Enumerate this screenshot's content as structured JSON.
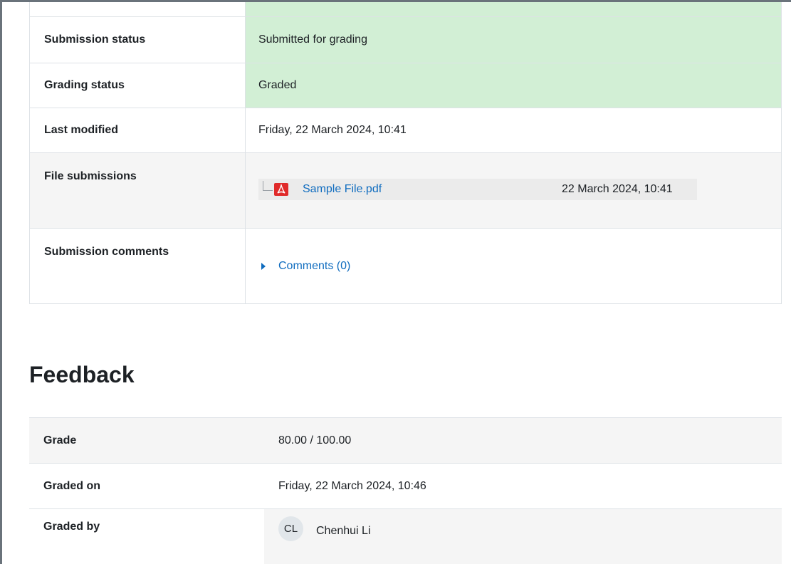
{
  "submission": {
    "rows": {
      "submission_status": {
        "label": "Submission status",
        "value": "Submitted for grading"
      },
      "grading_status": {
        "label": "Grading status",
        "value": "Graded"
      },
      "last_modified": {
        "label": "Last modified",
        "value": "Friday, 22 March 2024, 10:41"
      },
      "file_submissions": {
        "label": "File submissions",
        "file_name": "Sample File.pdf",
        "file_date": "22 March 2024, 10:41",
        "icon": "pdf-file-icon"
      },
      "submission_comments": {
        "label": "Submission comments",
        "link": "Comments (0)"
      }
    },
    "colors": {
      "success_bg": "#d2efd5",
      "link": "#0f6cbf"
    }
  },
  "feedback": {
    "heading": "Feedback",
    "grade": {
      "label": "Grade",
      "value": "80.00 / 100.00"
    },
    "graded_on": {
      "label": "Graded on",
      "value": "Friday, 22 March 2024, 10:46"
    },
    "graded_by": {
      "label": "Graded by",
      "initials": "CL",
      "name": "Chenhui Li"
    }
  }
}
